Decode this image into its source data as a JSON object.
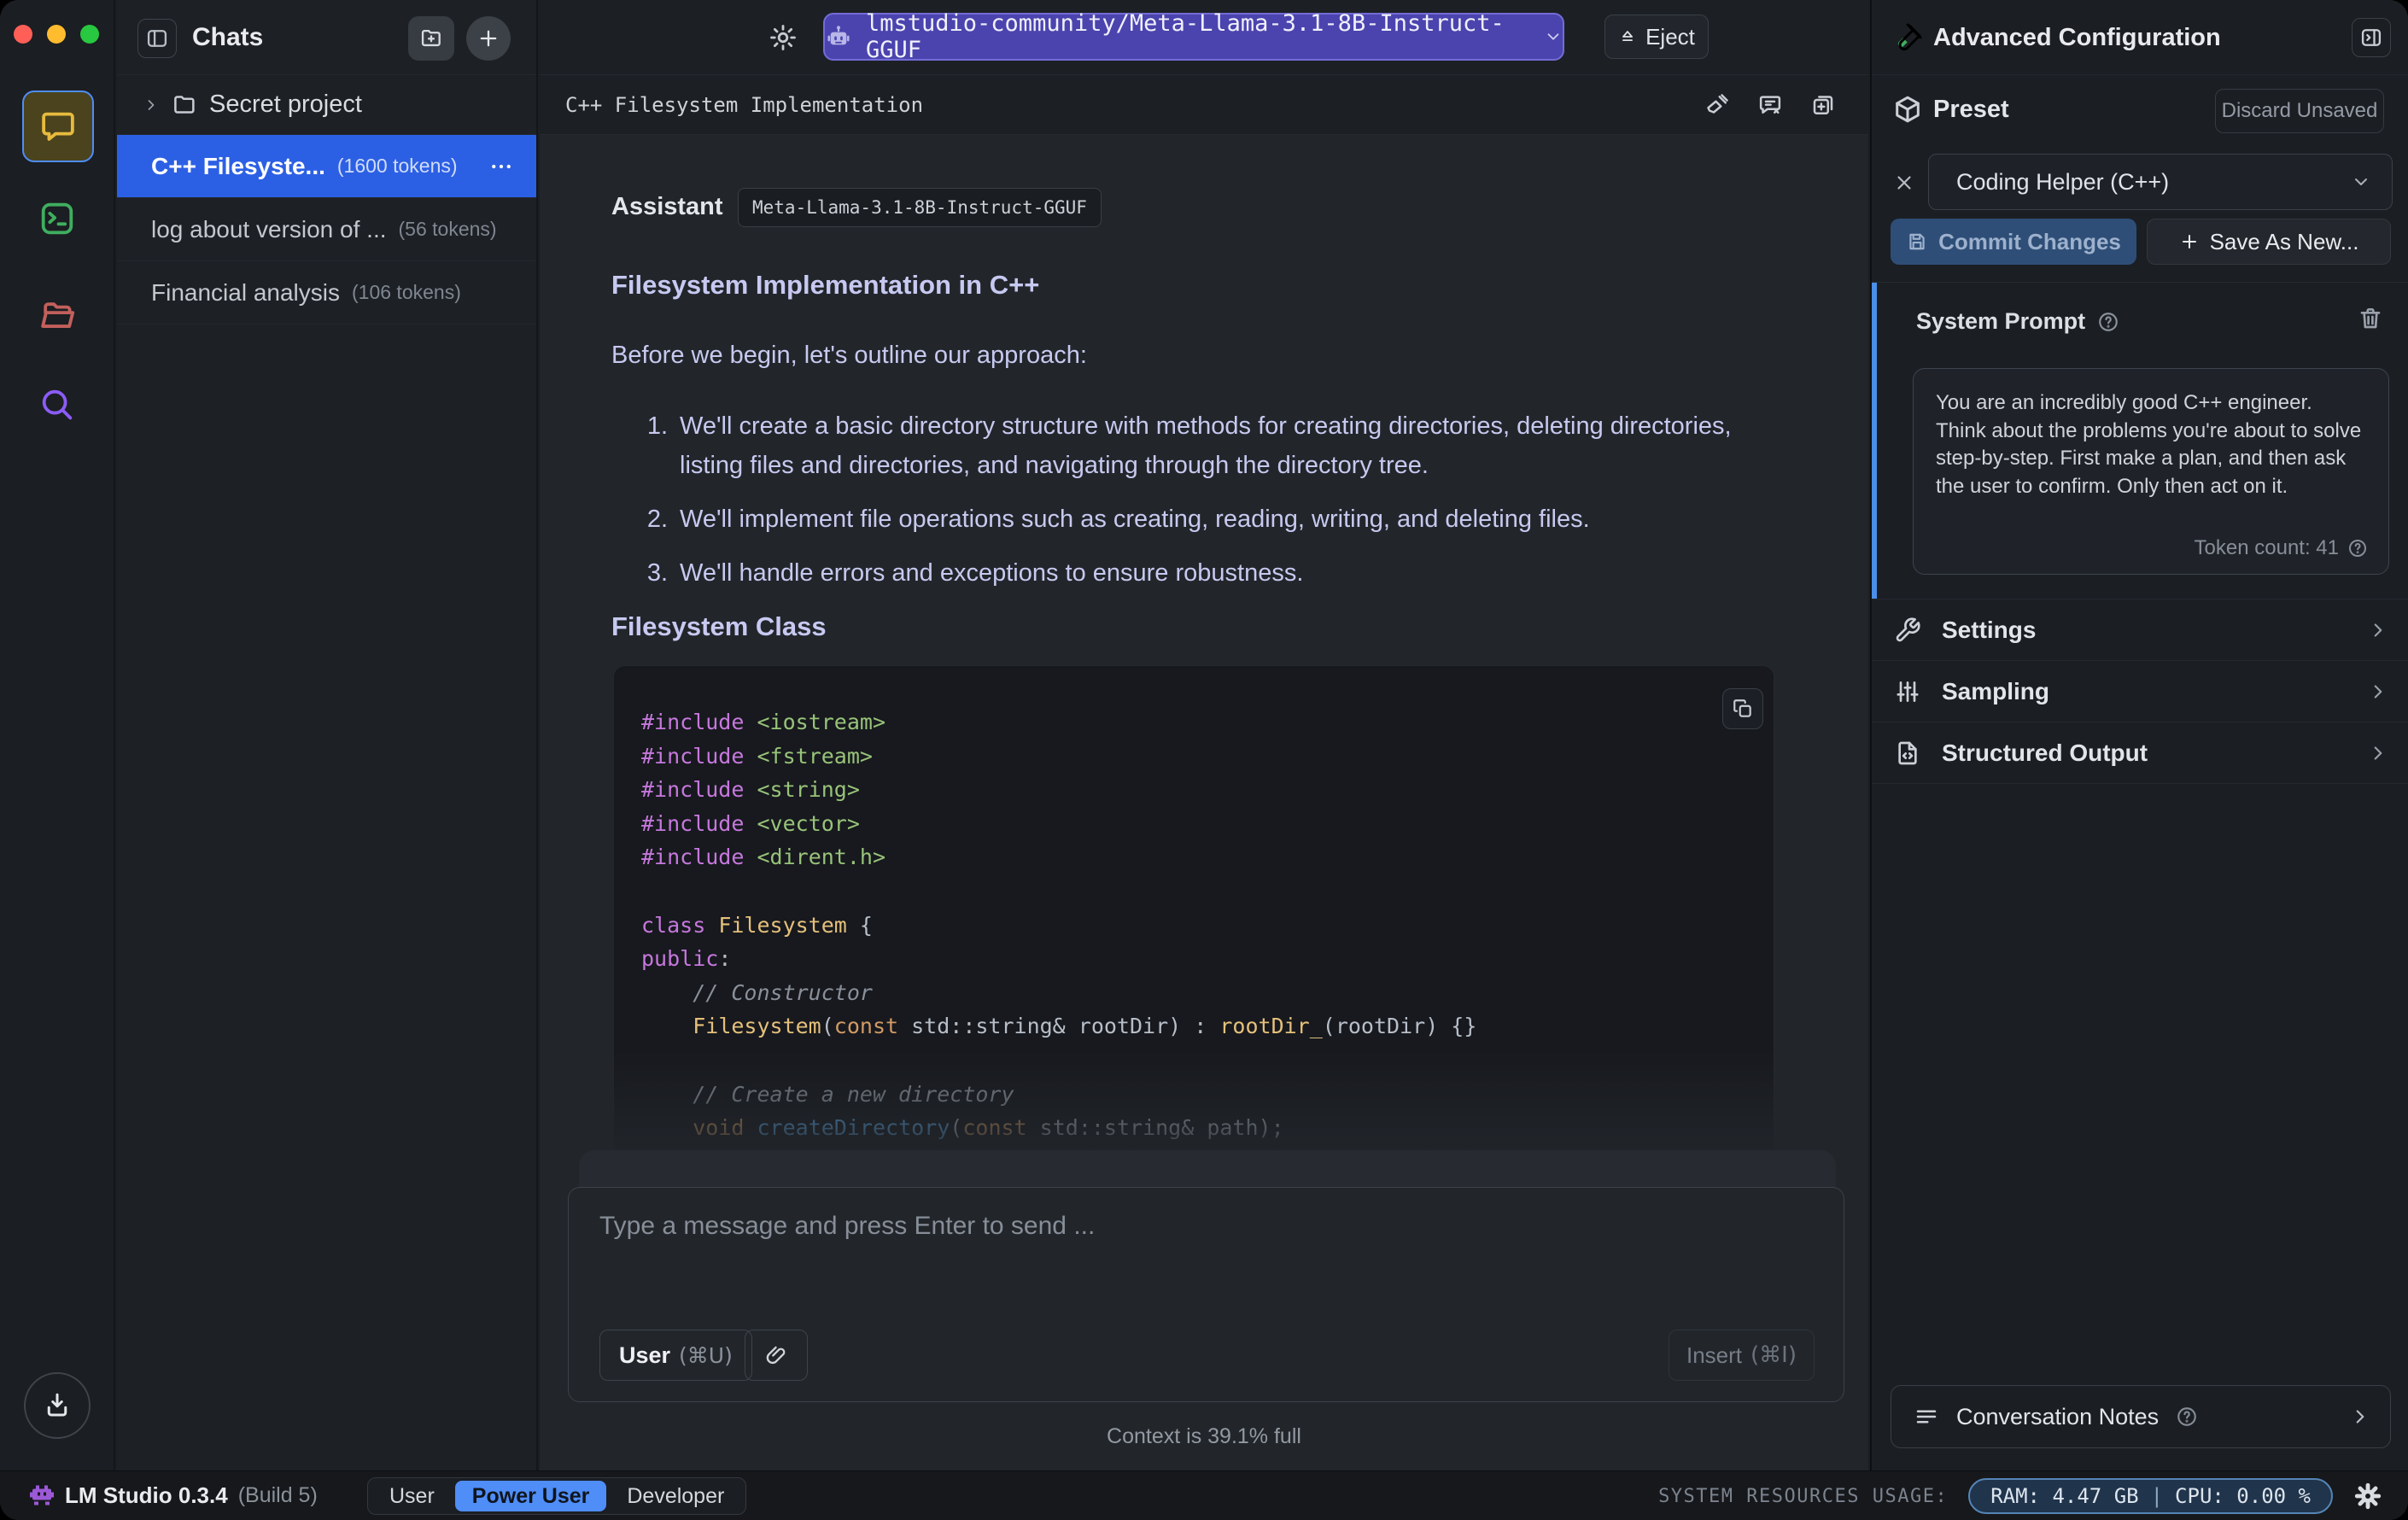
{
  "topbar": {
    "model_name": "lmstudio-community/Meta-Llama-3.1-8B-Instruct-GGUF",
    "eject_label": "Eject"
  },
  "sidebar": {
    "title": "Chats",
    "project": {
      "name": "Secret project"
    },
    "chats": [
      {
        "title": "C++ Filesyste...",
        "tokens": "(1600 tokens)",
        "menu": "⋯"
      },
      {
        "title": "log about version of ...",
        "tokens": "(56 tokens)"
      },
      {
        "title": "Financial analysis",
        "tokens": "(106 tokens)"
      }
    ]
  },
  "chat": {
    "title": "C++ Filesystem Implementation",
    "assistant_label": "Assistant",
    "model_badge": "Meta-Llama-3.1-8B-Instruct-GGUF",
    "heading1": "Filesystem Implementation in C++",
    "intro": "Before we begin, let's outline our approach:",
    "list": [
      {
        "n": "1.",
        "text": "We'll create a basic directory structure with methods for creating directories, deleting directories, listing files and directories, and navigating through the directory tree."
      },
      {
        "n": "2.",
        "text": "We'll implement file operations such as creating, reading, writing, and deleting files."
      },
      {
        "n": "3.",
        "text": "We'll handle errors and exceptions to ensure robustness."
      }
    ],
    "heading2": "Filesystem Class",
    "code": {
      "lines": [
        [
          [
            "kw",
            "#include"
          ],
          [
            "pl",
            " "
          ],
          [
            "str",
            "<iostream>"
          ]
        ],
        [
          [
            "kw",
            "#include"
          ],
          [
            "pl",
            " "
          ],
          [
            "str",
            "<fstream>"
          ]
        ],
        [
          [
            "kw",
            "#include"
          ],
          [
            "pl",
            " "
          ],
          [
            "str",
            "<string>"
          ]
        ],
        [
          [
            "kw",
            "#include"
          ],
          [
            "pl",
            " "
          ],
          [
            "str",
            "<vector>"
          ]
        ],
        [
          [
            "kw",
            "#include"
          ],
          [
            "pl",
            " "
          ],
          [
            "str",
            "<dirent.h>"
          ]
        ],
        [],
        [
          [
            "kw",
            "class"
          ],
          [
            "pl",
            " "
          ],
          [
            "cls",
            "Filesystem"
          ],
          [
            "pl",
            " {"
          ]
        ],
        [
          [
            "kw",
            "public"
          ],
          [
            "pl",
            ":"
          ]
        ],
        [
          [
            "pl",
            "    "
          ],
          [
            "cmt",
            "// Constructor"
          ]
        ],
        [
          [
            "pl",
            "    "
          ],
          [
            "cls",
            "Filesystem"
          ],
          [
            "pl",
            "("
          ],
          [
            "typ",
            "const"
          ],
          [
            "pl",
            " std::string& rootDir) : "
          ],
          [
            "cls",
            "rootDir_"
          ],
          [
            "pl",
            "(rootDir) {}"
          ]
        ],
        [],
        [
          [
            "pl",
            "    "
          ],
          [
            "cmt",
            "// Create a new directory"
          ]
        ],
        [
          [
            "pl",
            "    "
          ],
          [
            "typ",
            "void"
          ],
          [
            "pl",
            " "
          ],
          [
            "fn",
            "createDirectory"
          ],
          [
            "pl",
            "("
          ],
          [
            "typ",
            "const"
          ],
          [
            "pl",
            " std::string& path);"
          ]
        ]
      ]
    },
    "input": {
      "placeholder": "Type a message and press Enter to send ...",
      "role_label": "User",
      "role_shortcut": "(⌘U)",
      "insert_label": "Insert",
      "insert_shortcut": "(⌘I)"
    },
    "context_status": "Context is 39.1% full"
  },
  "panel": {
    "title": "Advanced Configuration",
    "preset": {
      "label": "Preset",
      "discard_label": "Discard Unsaved",
      "value": "Coding Helper (C++)",
      "commit_label": "Commit Changes",
      "save_label": "Save As New..."
    },
    "system_prompt": {
      "label": "System Prompt",
      "text": "You are an incredibly good C++ engineer. Think about the problems you're about to solve step-by-step. First make a plan, and then ask the user to confirm. Only then act on it.",
      "token_count": "Token count: 41"
    },
    "sections": [
      "Settings",
      "Sampling",
      "Structured Output"
    ],
    "notes_label": "Conversation Notes"
  },
  "statusbar": {
    "app_name": "LM Studio 0.3.4",
    "build": "(Build 5)",
    "modes": [
      "User",
      "Power User",
      "Developer"
    ],
    "active_mode": "Power User",
    "resources_label": "SYSTEM RESOURCES USAGE:",
    "ram": "RAM: 4.47 GB",
    "divider": "|",
    "cpu": "CPU: 0.00 %"
  },
  "colors": {
    "selection_blue": "#2c60e4",
    "model_pill_purple": "#4b44ae",
    "mode_active_blue": "#4f8df7",
    "system_prompt_accent": "#4a8fe8",
    "ram_pill_border": "#5585b5",
    "rail_chat_yellow": "#e7bb3e",
    "rail_terminal_green": "#3fae5f",
    "rail_folder_red": "#c2605c",
    "rail_search_purple": "#8b5cf6"
  }
}
